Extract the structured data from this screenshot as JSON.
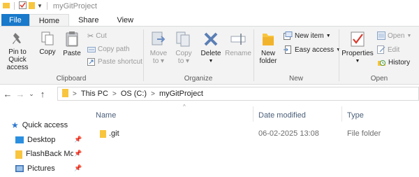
{
  "window": {
    "title": "myGitProject"
  },
  "tabs": [
    {
      "label": "File"
    },
    {
      "label": "Home"
    },
    {
      "label": "Share"
    },
    {
      "label": "View"
    }
  ],
  "ribbon": {
    "clipboard": {
      "pin_label": "Pin to Quick access",
      "pin_line1": "Pin to Quick",
      "pin_line2": "access",
      "copy": "Copy",
      "paste": "Paste",
      "cut": "Cut",
      "copy_path": "Copy path",
      "paste_shortcut": "Paste shortcut",
      "group": "Clipboard"
    },
    "organize": {
      "move_to_1": "Move",
      "move_to_2": "to",
      "copy_to_1": "Copy",
      "copy_to_2": "to",
      "delete": "Delete",
      "rename": "Rename",
      "group": "Organize"
    },
    "new": {
      "new_folder_1": "New",
      "new_folder_2": "folder",
      "new_item": "New item",
      "easy_access": "Easy access",
      "group": "New"
    },
    "open": {
      "properties": "Properties",
      "open": "Open",
      "edit": "Edit",
      "history": "History",
      "group": "Open"
    }
  },
  "address": {
    "crumbs": [
      "This PC",
      "OS (C:)",
      "myGitProject"
    ]
  },
  "navpane": {
    "items": [
      {
        "label": "Quick access"
      },
      {
        "label": "Desktop"
      },
      {
        "label": "FlashBack Mov"
      },
      {
        "label": "Pictures"
      }
    ]
  },
  "columns": {
    "name": "Name",
    "date": "Date modified",
    "type": "Type"
  },
  "files": [
    {
      "name": ".git",
      "date": "06-02-2025 13:08",
      "type": "File folder"
    }
  ],
  "colors": {
    "accent": "#1979ca",
    "folder": "#f8c53f",
    "ribbon_bg": "#f3f3f3"
  }
}
